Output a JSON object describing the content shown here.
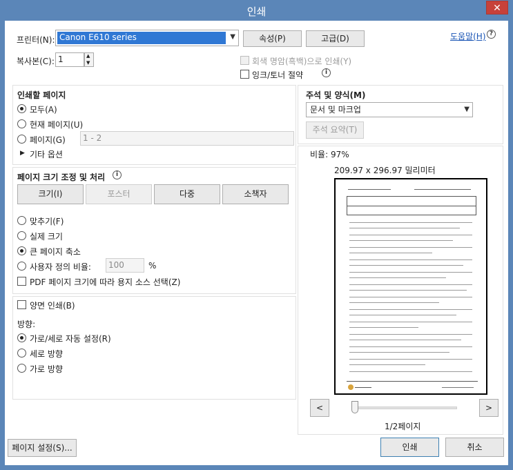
{
  "window": {
    "title": "인쇄",
    "close_glyph": "✕"
  },
  "printer": {
    "label": "프린터(N):",
    "selected": "Canon E610 series",
    "properties_button": "속성(P)",
    "advanced_button": "고급(D)",
    "help_link": "도움말(H)",
    "help_icon": "?"
  },
  "copies": {
    "label": "복사본(C):",
    "value": "1"
  },
  "options": {
    "grayscale": "회색 명암(흑백)으로 인쇄(Y)",
    "ink_save": "잉크/토너 절약",
    "info_glyph": "i"
  },
  "pages_to_print": {
    "heading": "인쇄할 페이지",
    "all": "모두(A)",
    "current": "현재 페이지(U)",
    "pages": "페이지(G)",
    "pages_placeholder": "1 - 2",
    "more": "기타 옵션"
  },
  "page_sizing": {
    "heading": "페이지 크기 조정 및 처리",
    "info_glyph": "i",
    "tabs": [
      "크기(I)",
      "포스터",
      "다중",
      "소책자"
    ],
    "fit": "맞추기(F)",
    "actual": "실제 크기",
    "shrink": "큰 페이지 축소",
    "custom": "사용자 정의 비율:",
    "custom_value": "100",
    "percent": "%",
    "pdf_source": "PDF 페이지 크기에 따라 용지 소스 선택(Z)"
  },
  "duplex": {
    "label": "양면 인쇄(B)"
  },
  "orientation": {
    "heading": "방향:",
    "auto": "가로/세로 자동 설정(R)",
    "portrait": "세로 방향",
    "landscape": "가로 방향"
  },
  "comments": {
    "heading": "주석 및 양식(M)",
    "selected": "문서 및 마크업",
    "summary_button": "주석 요약(T)"
  },
  "preview": {
    "scale": "비율:  97%",
    "size": "209.97 x 296.97 밀리미터",
    "page_status": "1/2페이지",
    "prev": "<",
    "next": ">"
  },
  "footer": {
    "page_setup": "페이지 설정(S)...",
    "print": "인쇄",
    "cancel": "취소"
  }
}
